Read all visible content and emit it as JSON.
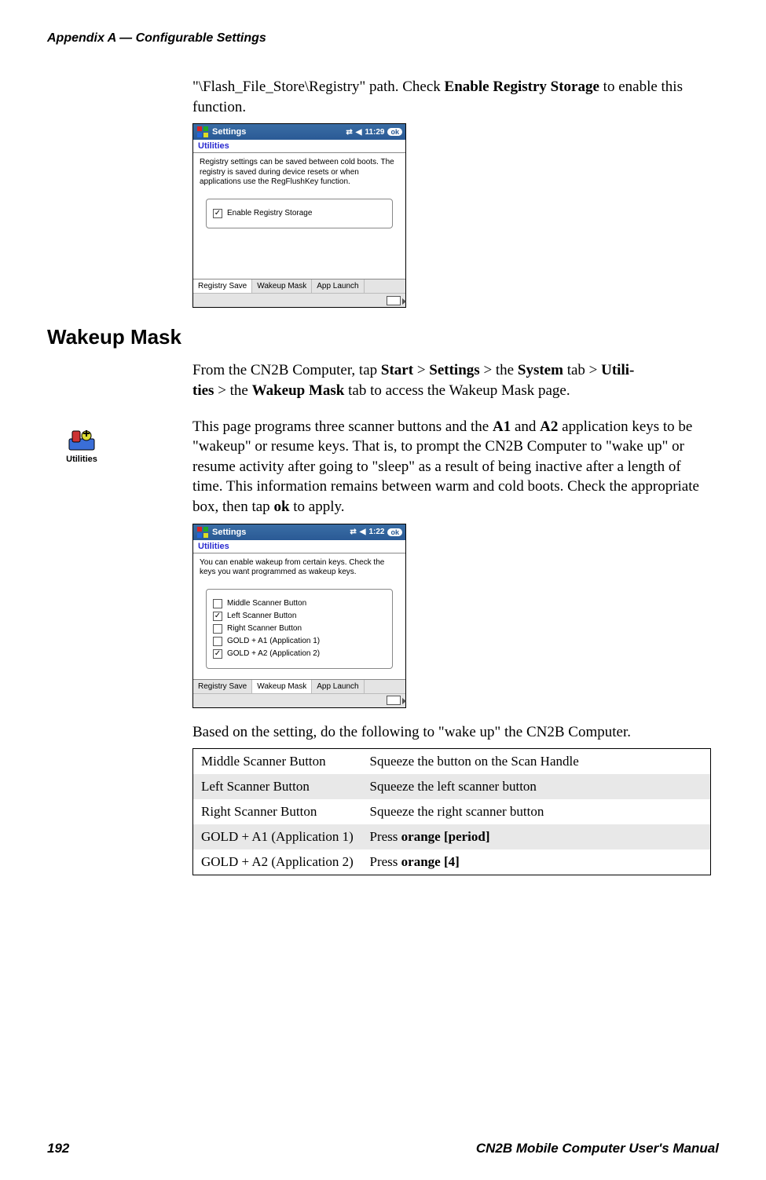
{
  "header": {
    "title": "Appendix A — Configurable Settings"
  },
  "intro": {
    "pre": "\"\\Flash_File_Store\\Registry\" path. Check ",
    "bold": "Enable Registry Storage",
    "post": " to enable this function."
  },
  "shot1": {
    "title": "Settings",
    "time": "11:29",
    "ok": "ok",
    "sub": "Utilities",
    "desc": "Registry settings can be saved between cold boots. The registry is saved during device resets or when applications use the RegFlushKey function.",
    "check_label": "Enable Registry Storage",
    "check_checked": true,
    "tabs": [
      "Registry Save",
      "Wakeup Mask",
      "App Launch"
    ],
    "active_tab": 0
  },
  "section_heading": "Wakeup Mask",
  "utilities_icon_label": "Utilities",
  "para1": {
    "pre": "From the CN2B Computer, tap ",
    "parts": [
      "Start",
      " > ",
      "Settings",
      " > the ",
      "System",
      " tab > ",
      "Utili-"
    ],
    "line2_parts": [
      "ties",
      " > the ",
      "Wakeup Mask",
      " tab to access the Wakeup Mask page."
    ]
  },
  "para2": {
    "text_pre": "This page programs three scanner buttons and the ",
    "a1": "A1",
    "mid1": " and ",
    "a2": "A2",
    "text_mid": " application keys to be \"wakeup\" or resume keys. That is, to prompt the CN2B Com­puter to \"wake up\" or resume activity after going to \"sleep\" as a result of being inactive after a length of time. This information remains between warm and cold boots. Check the appropriate box, then tap ",
    "ok": "ok",
    "text_post": " to apply."
  },
  "shot2": {
    "title": "Settings",
    "time": "1:22",
    "ok": "ok",
    "sub": "Utilities",
    "desc": "You can enable wakeup from certain keys. Check the keys you want programmed as wakeup keys.",
    "checks": [
      {
        "label": "Middle Scanner Button",
        "checked": false
      },
      {
        "label": "Left Scanner Button",
        "checked": true
      },
      {
        "label": "Right Scanner Button",
        "checked": false
      },
      {
        "label": "GOLD + A1 (Application 1)",
        "checked": false
      },
      {
        "label": "GOLD + A2 (Application 2)",
        "checked": true
      }
    ],
    "tabs": [
      "Registry Save",
      "Wakeup Mask",
      "App Launch"
    ],
    "active_tab": 1
  },
  "para3": "Based on the setting, do the following to \"wake up\" the CN2B Computer.",
  "table": {
    "rows": [
      {
        "k": "Middle Scanner Button",
        "v_pre": "Squeeze the button on the Scan Handle",
        "v_bold": "",
        "v_post": "",
        "shade": false
      },
      {
        "k": "Left Scanner Button",
        "v_pre": "Squeeze the left scanner button",
        "v_bold": "",
        "v_post": "",
        "shade": true
      },
      {
        "k": "Right Scanner Button",
        "v_pre": "Squeeze the right scanner button",
        "v_bold": "",
        "v_post": "",
        "shade": false
      },
      {
        "k": "GOLD + A1 (Application 1)",
        "v_pre": "Press ",
        "v_bold": "orange [period]",
        "v_post": "",
        "shade": true
      },
      {
        "k": "GOLD + A2 (Application 2)",
        "v_pre": "Press ",
        "v_bold": "orange [4]",
        "v_post": "",
        "shade": false
      }
    ]
  },
  "footer": {
    "page": "192",
    "manual": "CN2B Mobile Computer User's Manual"
  }
}
